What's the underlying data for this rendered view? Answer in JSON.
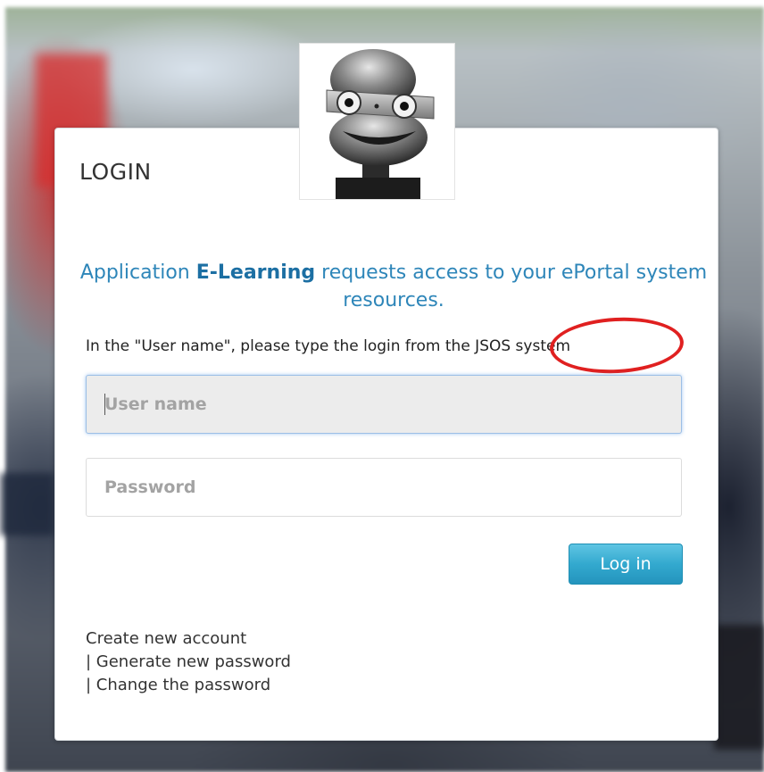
{
  "login": {
    "title": "LOGIN",
    "request": {
      "prefix": "Application ",
      "app_name": "E-Learning",
      "suffix": " requests access to your ePortal system resources."
    },
    "hint": "In the \"User name\", please type the login from the JSOS system",
    "username_placeholder": "User name",
    "password_placeholder": "Password",
    "login_button": "Log in",
    "links": {
      "create_account": "Create new account",
      "generate_password": "| Generate new password",
      "change_password": "| Change the password"
    }
  },
  "colors": {
    "accent_text": "#2e86b9",
    "button": "#33a9cf",
    "annotation": "#e02020"
  },
  "icons": {
    "avatar": "robot-head-icon"
  }
}
